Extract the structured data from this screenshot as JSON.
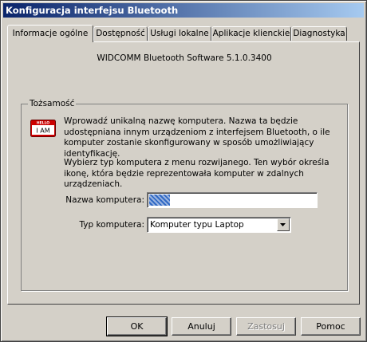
{
  "window": {
    "title": "Konfiguracja interfejsu Bluetooth"
  },
  "tabs": [
    {
      "label": "Informacje ogólne",
      "active": true
    },
    {
      "label": "Dostępność",
      "active": false
    },
    {
      "label": "Usługi lokalne",
      "active": false
    },
    {
      "label": "Aplikacje klienckie",
      "active": false
    },
    {
      "label": "Diagnostyka",
      "active": false
    }
  ],
  "general": {
    "version": "WIDCOMM Bluetooth Software 5.1.0.3400",
    "group_title": "Tożsamość",
    "icon": {
      "name": "hello-i-am-icon",
      "top_text": "HELLO",
      "main_text": "I AM",
      "color": "#cc0000"
    },
    "description_1": "Wprowadź unikalną nazwę komputera. Nazwa ta będzie udostępniana innym urządzeniom z interfejsem Bluetooth, o ile komputer zostanie skonfigurowany w sposób umożliwiający identyfikację.",
    "description_2": "Wybierz typ komputera z menu rozwijanego. Ten wybór określa ikonę, która będzie reprezentowała komputer w zdalnych urządzeniach.",
    "name_label": "Nazwa komputera:",
    "name_value": "",
    "type_label": "Typ komputera:",
    "type_value": "Komputer typu Laptop"
  },
  "buttons": {
    "ok": "OK",
    "cancel": "Anuluj",
    "apply": "Zastosuj",
    "help": "Pomoc"
  }
}
